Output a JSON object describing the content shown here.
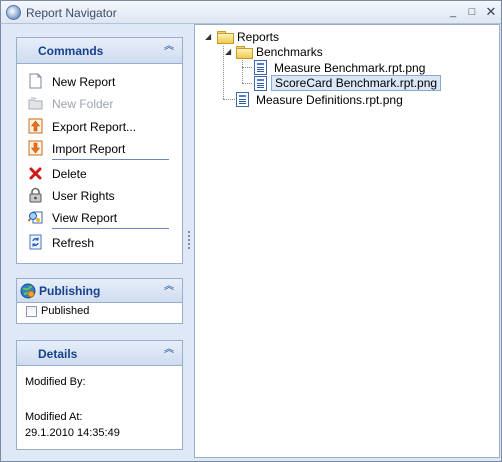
{
  "window": {
    "title": "Report Navigator",
    "min_glyph": "_",
    "max_glyph": "□",
    "close_glyph": "✕"
  },
  "commands_panel": {
    "title": "Commands",
    "collapse_glyph": "⌃",
    "items": [
      {
        "label": "New Report",
        "icon": "new-report-icon",
        "enabled": true
      },
      {
        "label": "New Folder",
        "icon": "new-folder-icon",
        "enabled": false
      },
      {
        "label": "Export Report...",
        "icon": "export-report-icon",
        "enabled": true
      },
      {
        "label": "Import Report",
        "icon": "import-report-icon",
        "enabled": true
      },
      {
        "label": "Delete",
        "icon": "delete-icon",
        "enabled": true
      },
      {
        "label": "User Rights",
        "icon": "user-rights-lock-icon",
        "enabled": true
      },
      {
        "label": "View Report",
        "icon": "view-report-icon",
        "enabled": true
      },
      {
        "label": "Refresh",
        "icon": "refresh-icon",
        "enabled": true
      }
    ]
  },
  "publishing_panel": {
    "title": "Publishing",
    "published_label": "Published",
    "published_checked": false
  },
  "details_panel": {
    "title": "Details",
    "modified_by_label": "Modified By:",
    "modified_by_value": "",
    "modified_at_label": "Modified At:",
    "modified_at_value": "29.1.2010 14:35:49"
  },
  "tree": {
    "root": {
      "label": "Reports",
      "expanded": true,
      "children": [
        {
          "label": "Benchmarks",
          "expanded": true,
          "children": [
            {
              "label": "Measure Benchmark.rpt.png",
              "selected": false
            },
            {
              "label": "ScoreCard Benchmark.rpt.png",
              "selected": true
            }
          ]
        },
        {
          "label": "Measure Definitions.rpt.png",
          "selected": false
        }
      ]
    },
    "expander_glyph": "◢"
  },
  "colors": {
    "panel_header_text": "#15428b",
    "panel_border": "#99aecb",
    "window_bg": "#dfe8f6",
    "selection_bg": "#dbe7f8"
  }
}
